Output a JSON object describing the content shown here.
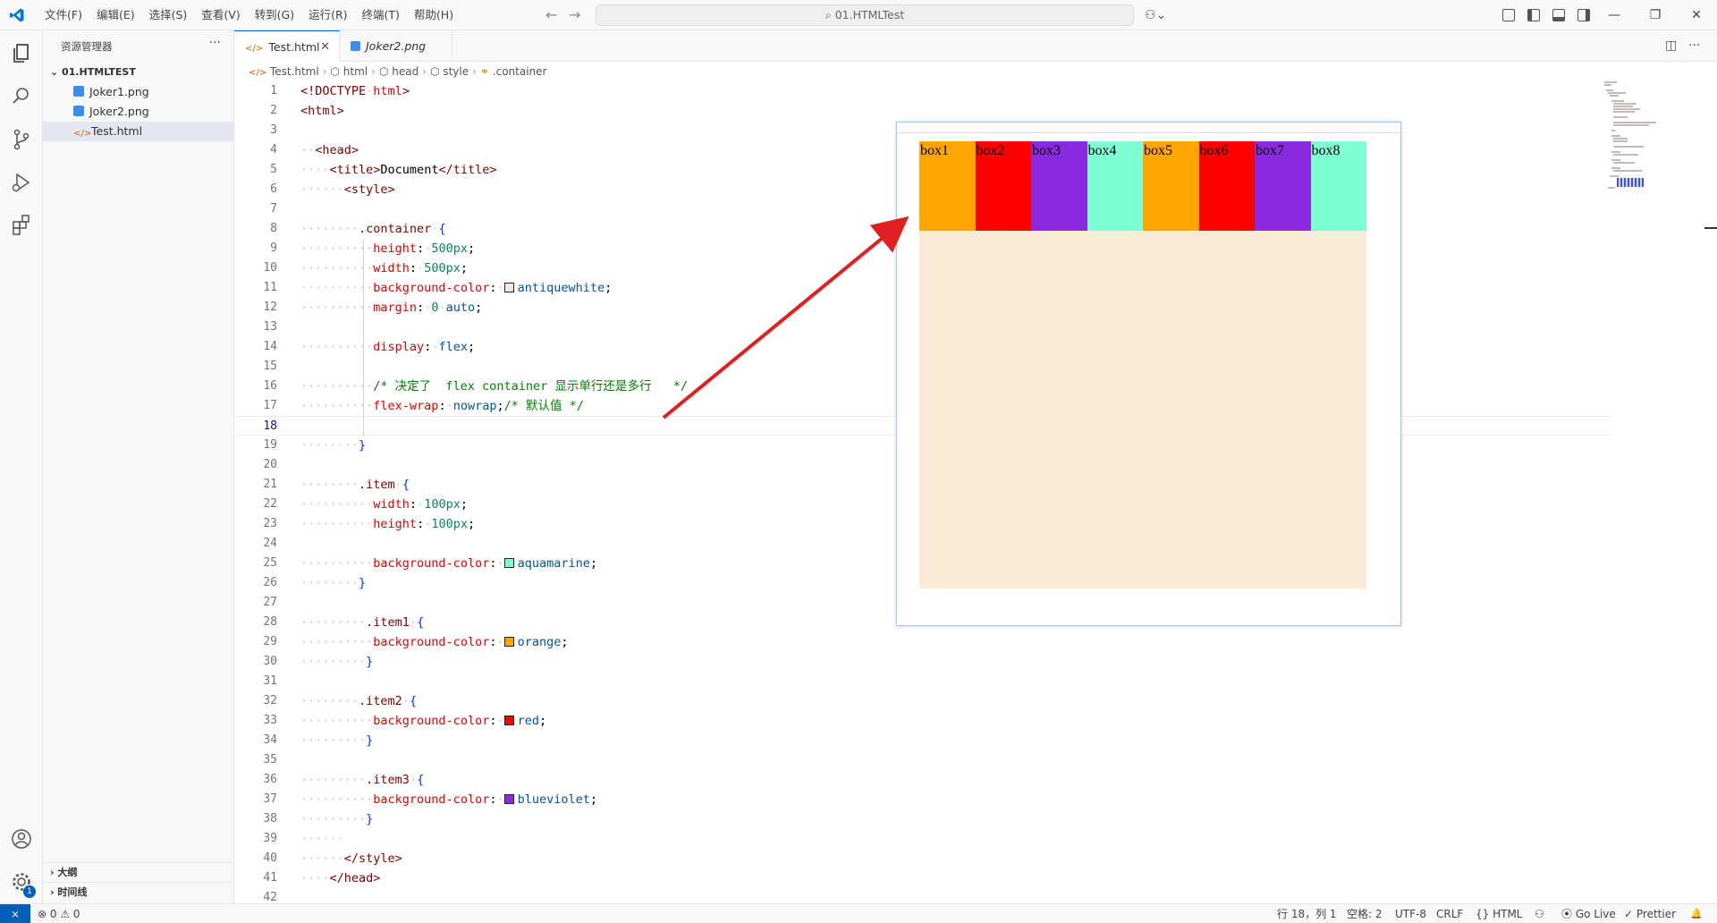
{
  "titlebar": {
    "menus": [
      "文件(F)",
      "编辑(E)",
      "选择(S)",
      "查看(V)",
      "转到(G)",
      "运行(R)",
      "终端(T)",
      "帮助(H)"
    ],
    "search_text": "01.HTMLTest",
    "back_glyph": "←",
    "forward_glyph": "→",
    "copilot_glyph": "⚇⌄",
    "minimize_glyph": "—",
    "restore_glyph": "❐",
    "close_glyph": "✕"
  },
  "explorer": {
    "title": "资源管理器",
    "more": "···",
    "folder": "01.HTMLTEST",
    "files": [
      {
        "name": "Joker1.png",
        "type": "png"
      },
      {
        "name": "Joker2.png",
        "type": "png"
      },
      {
        "name": "Test.html",
        "type": "html",
        "selected": true
      }
    ],
    "outline": "大纲",
    "timeline": "时间线"
  },
  "tabs": [
    {
      "label": "Test.html",
      "active": true,
      "icon": "</>",
      "close": "✕"
    },
    {
      "label": "Joker2.png",
      "active": false
    }
  ],
  "tab_actions": {
    "split": "◫",
    "more": "···"
  },
  "breadcrumb": [
    "Test.html",
    "html",
    "head",
    "style",
    ".container"
  ],
  "code_lines": [
    "1",
    "2",
    "3",
    "4",
    "5",
    "6",
    "7",
    "8",
    "9",
    "10",
    "11",
    "12",
    "13",
    "14",
    "15",
    "16",
    "17",
    "18",
    "19",
    "20",
    "21",
    "22",
    "23",
    "24",
    "25",
    "26",
    "27",
    "28",
    "29",
    "30",
    "31",
    "32",
    "33",
    "34",
    "35",
    "36",
    "37",
    "38",
    "39",
    "40",
    "41",
    "42"
  ],
  "code": {
    "l1a": "<!DOCTYPE",
    "l1b": "html",
    "l1c": ">",
    "l2": "<html>",
    "l4": "<head>",
    "l5a": "<title>",
    "l5b": "Document",
    "l5c": "</title>",
    "l6": "<style>",
    "l8a": ".container",
    "l8b": "{",
    "l9a": "height",
    "l9b": "500px",
    "l10a": "width",
    "l10b": "500px",
    "l11a": "background-color",
    "l11b": "antiquewhite",
    "l12a": "margin",
    "l12b": "0",
    "l12c": "auto",
    "l14a": "display",
    "l14b": "flex",
    "l16": "/* 决定了  flex container 显示单行还是多行   */",
    "l17a": "flex-wrap",
    "l17b": "nowrap",
    "l17c": "/* 默认值 */",
    "l19": "}",
    "l21a": ".item",
    "l21b": "{",
    "l22a": "width",
    "l22b": "100px",
    "l23a": "height",
    "l23b": "100px",
    "l25a": "background-color",
    "l25b": "aquamarine",
    "l26": "}",
    "l28a": ".item1",
    "l28b": "{",
    "l29a": "background-color",
    "l29b": "orange",
    "l30": "}",
    "l32a": ".item2",
    "l32b": "{",
    "l33a": "background-color",
    "l33b": "red",
    "l34": "}",
    "l36a": ".item3",
    "l36b": "{",
    "l37a": "background-color",
    "l37b": "blueviolet",
    "l38": "}",
    "l40": "</style>",
    "l41": "</head>"
  },
  "swatch_colors": {
    "antiquewhite": "#faebd7",
    "aquamarine": "#7fffd4",
    "orange": "#ffa500",
    "red": "#ff0000",
    "blueviolet": "#8a2be2"
  },
  "preview": {
    "boxes": [
      {
        "label": "box1",
        "color": "#ffa500"
      },
      {
        "label": "box2",
        "color": "#ff0000"
      },
      {
        "label": "box3",
        "color": "#8a2be2"
      },
      {
        "label": "box4",
        "color": "#7fffd4"
      },
      {
        "label": "box5",
        "color": "#ffa500"
      },
      {
        "label": "box6",
        "color": "#ff0000"
      },
      {
        "label": "box7",
        "color": "#8a2be2"
      },
      {
        "label": "box8",
        "color": "#7fffd4"
      }
    ]
  },
  "statusbar": {
    "remote": "⨯",
    "problems": "⊗ 0 ⚠ 0",
    "position": "行 18，列 1",
    "spaces": "空格: 2",
    "encoding": "UTF-8",
    "eol": "CRLF",
    "language": "{} HTML",
    "copilot": "⚇",
    "golive": "⦿ Go Live",
    "prettier": "✓ Prettier",
    "bell": "🔔"
  },
  "activity_badge": "1",
  "accent_color": "#005fb8",
  "annotation_arrow_color": "#e02020"
}
